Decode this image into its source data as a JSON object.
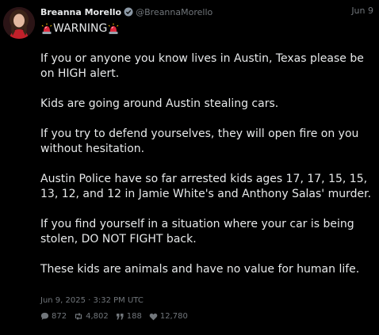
{
  "tweet": {
    "author_name": "Breanna Morello",
    "handle": "@BreannaMorello",
    "date": "Jun 9",
    "title": "WARNING",
    "paragraphs": [
      "If you or anyone you know lives in Austin, Texas please be on HIGH alert.",
      "Kids are going around Austin stealing cars.",
      "If you try to defend yourselves, they will open fire on you without hesitation.",
      "Austin Police have so far arrested kids ages 17, 17, 15, 15, 13, 12, and 12 in Jamie White's and Anthony Salas' murder.",
      "If you find yourself in a situation where your car is being stolen, DO NOT FIGHT back.",
      "These kids are animals and have no value for human life."
    ],
    "timestamp": "Jun 9, 2025 · 3:32 PM UTC",
    "stats": {
      "replies": "872",
      "retweets": "4,802",
      "quotes": "188",
      "likes": "12,780"
    }
  },
  "icons": {
    "verified": "verified-badge-icon",
    "siren": "police-siren-icon",
    "reply": "comment-icon",
    "retweet": "retweet-icon",
    "quote": "quote-icon",
    "like": "heart-icon"
  },
  "colors": {
    "background": "#000000",
    "text": "#e7e9ea",
    "muted": "#71767b",
    "verified": "#8b98a5",
    "siren": "#e0283c"
  }
}
